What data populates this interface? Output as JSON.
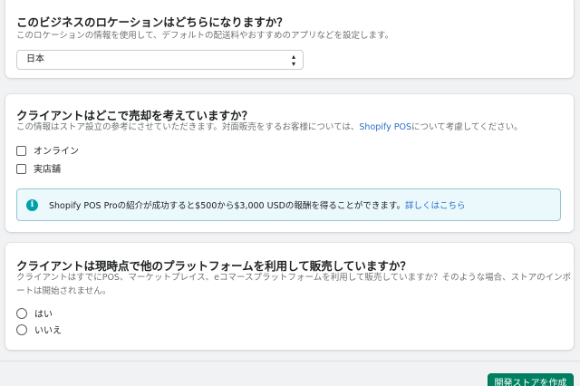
{
  "location": {
    "title": "このビジネスのロケーションはどちらになりますか？",
    "description": "このロケーションの情報を使用して、デフォルトの配送料やおすすめのアプリなどを設定します。",
    "select_value": "日本"
  },
  "sales": {
    "title": "クライアントはどこで売却を考えていますか？",
    "description_prefix": "この情報はストア設立の参考にさせていただきます。対面販売をするお客様については、",
    "description_link": "Shopify POS",
    "description_suffix": "について考慮してください。",
    "options": [
      {
        "label": "オンライン",
        "checked": false
      },
      {
        "label": "実店舗",
        "checked": false
      }
    ],
    "banner_text": "Shopify POS Proの紹介が成功すると$500から$3,000 USDの報酬を得ることができます。",
    "banner_link": "詳しくはこちら"
  },
  "platform": {
    "title": "クライアントは現時点で他のプラットフォームを利用して販売していますか？",
    "description_line1": "クライアントはすでにPOS、マーケットプレイス、eコマースプラットフォームを利用して販売していますか？そのような場合、ストアのインポ",
    "description_line2": "ートは開始されません。",
    "options": [
      {
        "label": "はい",
        "selected": false
      },
      {
        "label": "いいえ",
        "selected": false
      }
    ]
  },
  "footer": {
    "create_button": "開発ストアを作成"
  },
  "colors": {
    "primary_button": "#008060",
    "link": "#2c6ecb",
    "banner_bg": "#ebf9fc",
    "info_icon": "#00a0ac"
  },
  "icons": {
    "select_caret": "select-caret-icon",
    "info": "info-icon"
  }
}
